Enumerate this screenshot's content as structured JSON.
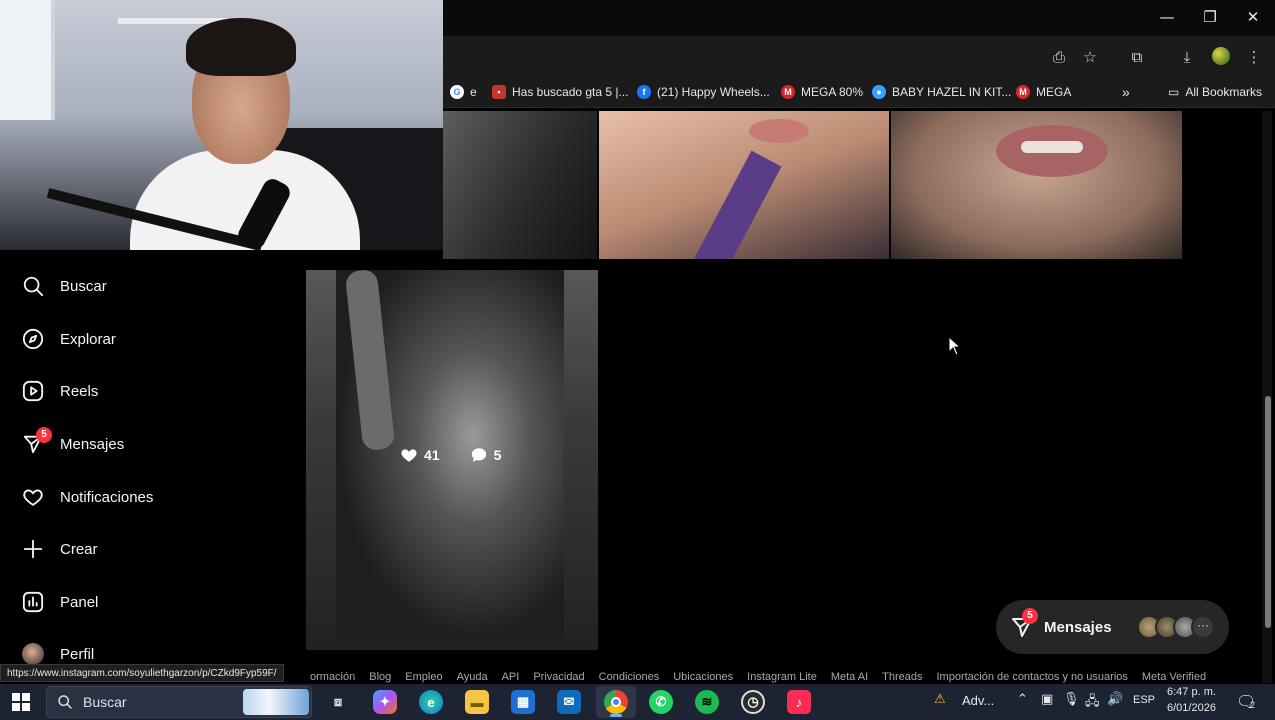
{
  "webcam": {
    "label": "streamer webcam overlay"
  },
  "bookmarks": [
    {
      "label": "e",
      "icon": "google-icon",
      "color": "#4285f4"
    },
    {
      "label": "Has buscado gta 5 |...",
      "icon": "site-icon",
      "color": "#c0392b"
    },
    {
      "label": "(21) Happy Wheels...",
      "icon": "facebook-icon",
      "color": "#1877f2"
    },
    {
      "label": "MEGA 80%",
      "icon": "mega-icon",
      "color": "#d9272e"
    },
    {
      "label": "BABY HAZEL IN KIT...",
      "icon": "globe-icon",
      "color": "#3aa0ff"
    },
    {
      "label": "MEGA",
      "icon": "mega-icon",
      "color": "#d9272e"
    }
  ],
  "all_bookmarks_label": "All Bookmarks",
  "sidebar": {
    "items": [
      {
        "label": "Buscar",
        "icon": "search-icon"
      },
      {
        "label": "Explorar",
        "icon": "compass-icon"
      },
      {
        "label": "Reels",
        "icon": "reels-icon"
      },
      {
        "label": "Mensajes",
        "icon": "messenger-icon",
        "badge": "5"
      },
      {
        "label": "Notificaciones",
        "icon": "heart-icon"
      },
      {
        "label": "Crear",
        "icon": "plus-icon"
      },
      {
        "label": "Panel",
        "icon": "chart-icon"
      },
      {
        "label": "Perfil",
        "icon": "avatar"
      }
    ]
  },
  "post_overlay": {
    "likes": "41",
    "comments": "5"
  },
  "status_url": "https://www.instagram.com/soyuliethgarzon/p/CZkd9Fyp59F/",
  "footer_links": [
    "ormación",
    "Blog",
    "Empleo",
    "Ayuda",
    "API",
    "Privacidad",
    "Condiciones",
    "Ubicaciones",
    "Instagram Lite",
    "Meta AI",
    "Threads",
    "Importación de contactos y no usuarios",
    "Meta Verified"
  ],
  "messages_pill": {
    "label": "Mensajes",
    "badge": "5",
    "more": "···"
  },
  "taskbar": {
    "search_placeholder": "Buscar",
    "tray_alert": "Adv...",
    "language": "ESP",
    "time": "6:47 p. m.",
    "date": "6/01/2026",
    "notifications": "2"
  },
  "colors": {
    "badge": "#ff3040",
    "background": "#000000",
    "taskbar": "#1c2333"
  }
}
